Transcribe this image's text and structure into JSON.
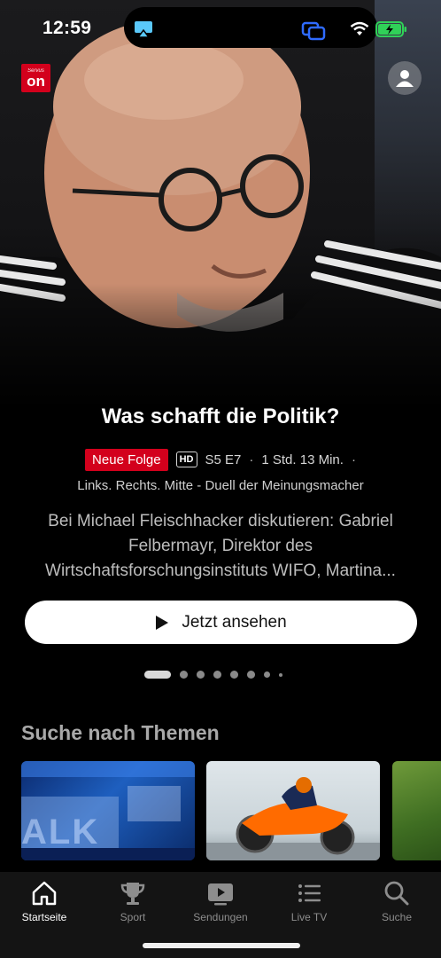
{
  "status_bar": {
    "time": "12:59"
  },
  "brand": {
    "logo_small": "Servus",
    "logo_big": "on"
  },
  "hero": {
    "title": "Was schafft die Politik?",
    "badge_new": "Neue Folge",
    "badge_quality": "HD",
    "episode": "S5 E7",
    "separator": "·",
    "duration": "1 Std. 13 Min.",
    "subtitle": "Links. Rechts. Mitte - Duell der Meinungsmacher",
    "description": "Bei Michael Fleischhacker diskutieren: Gabriel Felbermayr, Direktor des Wirtschaftsforschungsinstituts WIFO, Martina...",
    "watch_label": "Jetzt ansehen"
  },
  "pagination": {
    "total": 8,
    "active_index": 0
  },
  "themes": {
    "title": "Suche nach Themen",
    "card1_text": "ALK"
  },
  "tabs": [
    {
      "label": "Startseite",
      "icon": "home-icon",
      "active": true
    },
    {
      "label": "Sport",
      "icon": "trophy-icon",
      "active": false
    },
    {
      "label": "Sendungen",
      "icon": "play-screen-icon",
      "active": false
    },
    {
      "label": "Live TV",
      "icon": "list-icon",
      "active": false
    },
    {
      "label": "Suche",
      "icon": "search-icon",
      "active": false
    }
  ],
  "colors": {
    "accent_red": "#d3001c",
    "background": "#000000",
    "airplay_blue": "#5ac8fa",
    "battery_green": "#30d158"
  }
}
